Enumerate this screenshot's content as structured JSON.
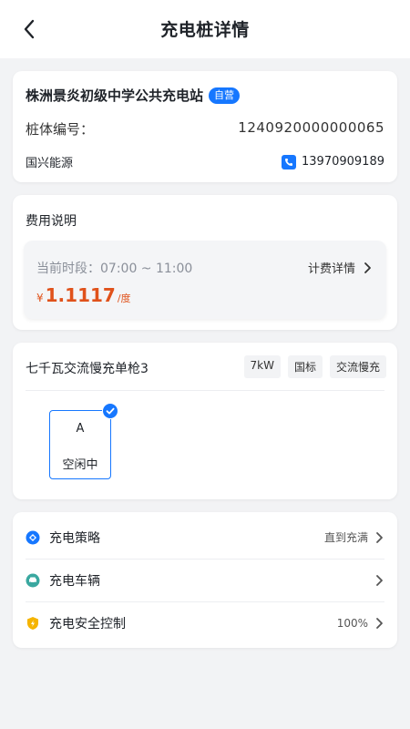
{
  "header": {
    "title": "充电桩详情"
  },
  "station": {
    "name": "株洲景炎初级中学公共充电站",
    "tag": "自营",
    "pile_label": "桩体编号：",
    "pile_number": "1240920000000065",
    "operator": "国兴能源",
    "phone": "13970909189"
  },
  "fee": {
    "title": "费用说明",
    "period": "当前时段：07:00 ~ 11:00",
    "detail_label": "计费详情",
    "currency": "¥",
    "price": "1.1117",
    "unit": "/度"
  },
  "gun": {
    "title": "七千瓦交流慢充单枪3",
    "tags": [
      "7kW",
      "国标",
      "交流慢充"
    ],
    "connector": {
      "letter": "A",
      "status": "空闲中"
    }
  },
  "settings": {
    "items": [
      {
        "label": "充电策略",
        "value": "直到充满"
      },
      {
        "label": "充电车辆",
        "value": ""
      },
      {
        "label": "充电安全控制",
        "value": "100%"
      }
    ]
  },
  "colors": {
    "accent": "#1677ff",
    "price": "#e0521b",
    "background": "#f2f3f5"
  }
}
